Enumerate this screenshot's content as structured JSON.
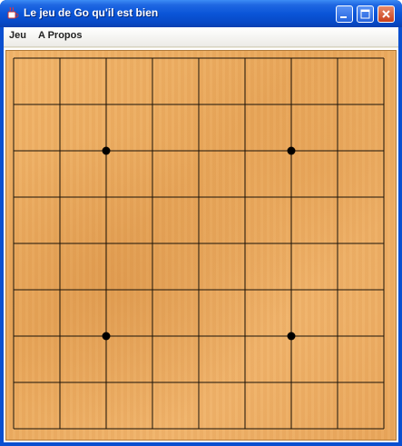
{
  "window": {
    "title": "Le jeu de Go qu'il est bien",
    "icon": "java-cup-icon",
    "controls": [
      "minimize-icon",
      "maximize-icon",
      "close-icon"
    ]
  },
  "menubar": {
    "items": [
      {
        "label": "Jeu"
      },
      {
        "label": "A Propos"
      }
    ]
  },
  "board": {
    "size": 9,
    "star_points": [
      [
        2,
        2
      ],
      [
        6,
        2
      ],
      [
        2,
        6
      ],
      [
        6,
        6
      ]
    ],
    "stones": [],
    "line_color": "#1a1208",
    "wood_color": "#eeb066"
  }
}
